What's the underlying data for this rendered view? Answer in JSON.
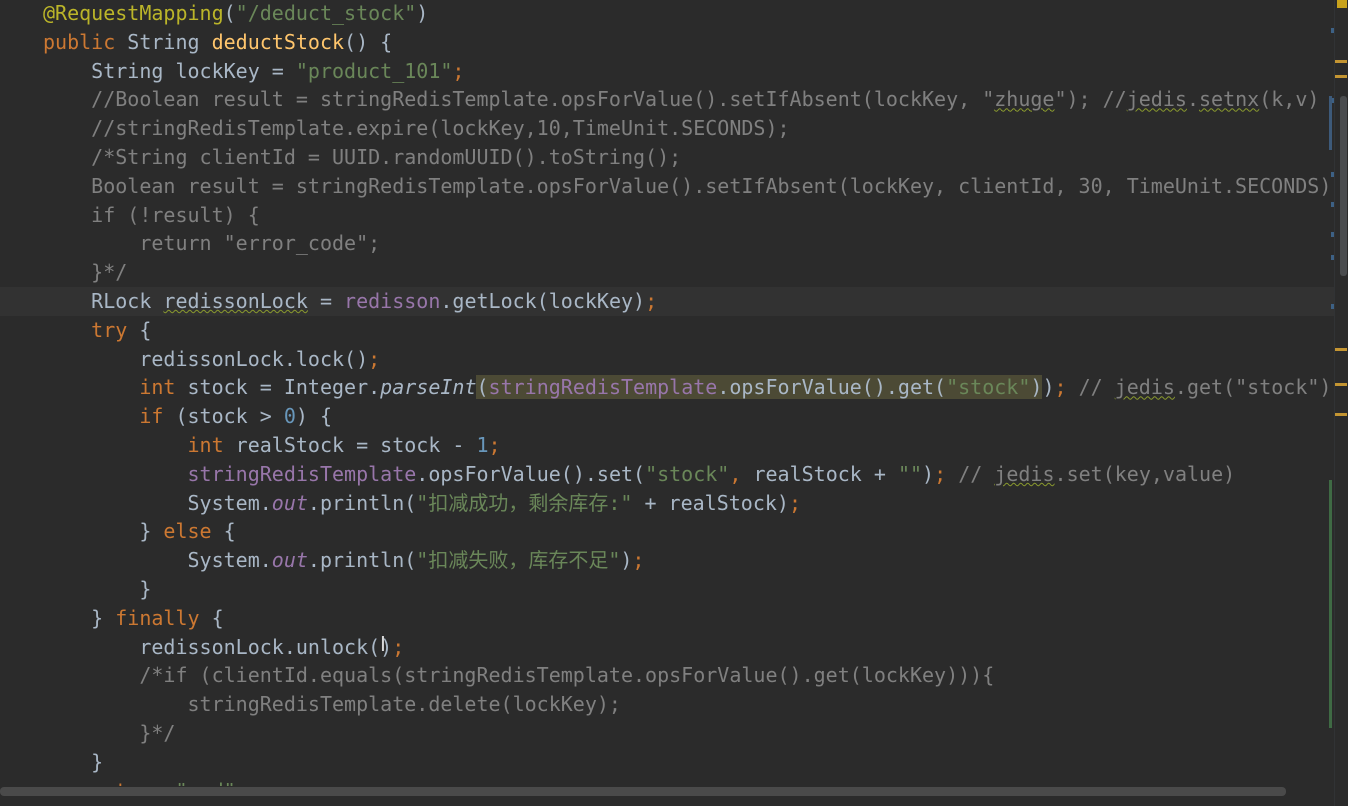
{
  "editor": {
    "theme_colors": {
      "background": "#2b2b2b",
      "current_line": "#323232",
      "keyword": "#cc7832",
      "string": "#6a8759",
      "comment": "#808080",
      "annotation": "#bbb529",
      "field": "#9876aa",
      "method_decl": "#ffc66d",
      "number": "#6897bb",
      "text": "#a9b7c6",
      "usage_highlight": "#4c4a35"
    },
    "lines": [
      [
        {
          "t": "@RequestMapping",
          "c": "ann"
        },
        {
          "t": "(",
          "c": ""
        },
        {
          "t": "\"/deduct_stock\"",
          "c": "str"
        },
        {
          "t": ")",
          "c": ""
        }
      ],
      [
        {
          "t": "public ",
          "c": "kw"
        },
        {
          "t": "String ",
          "c": ""
        },
        {
          "t": "deductStock",
          "c": "fn"
        },
        {
          "t": "() {",
          "c": ""
        }
      ],
      [
        {
          "t": "    String lockKey = ",
          "c": ""
        },
        {
          "t": "\"product_101\"",
          "c": "str"
        },
        {
          "t": ";",
          "c": "kw"
        }
      ],
      [
        {
          "t": "    //Boolean result = stringRedisTemplate.opsForValue().setIfAbsent(lockKey, \"",
          "c": "cmt"
        },
        {
          "t": "zhuge",
          "c": "cmt warn-ul"
        },
        {
          "t": "\"); //",
          "c": "cmt"
        },
        {
          "t": "jedis",
          "c": "cmt warn-ul"
        },
        {
          "t": ".",
          "c": "cmt"
        },
        {
          "t": "setnx",
          "c": "cmt warn-ul"
        },
        {
          "t": "(k,v)",
          "c": "cmt"
        }
      ],
      [
        {
          "t": "    //stringRedisTemplate.expire(lockKey,10,TimeUnit.SECONDS);",
          "c": "cmt"
        }
      ],
      [
        {
          "t": "    /*String clientId = UUID.randomUUID().toString();",
          "c": "cmt"
        }
      ],
      [
        {
          "t": "    Boolean result = stringRedisTemplate.opsForValue().setIfAbsent(lockKey, clientId, 30, TimeUnit.SECONDS);",
          "c": "cmt"
        }
      ],
      [
        {
          "t": "    if (!result) {",
          "c": "cmt"
        }
      ],
      [
        {
          "t": "        return \"error_code\";",
          "c": "cmt"
        }
      ],
      [
        {
          "t": "    }*/",
          "c": "cmt"
        }
      ],
      [
        {
          "t": "    RLock ",
          "c": ""
        },
        {
          "t": "redissonLock",
          "c": "warn-ul"
        },
        {
          "t": " = ",
          "c": ""
        },
        {
          "t": "redisson",
          "c": "fld"
        },
        {
          "t": ".getLock(lockKey)",
          "c": ""
        },
        {
          "t": ";",
          "c": "kw"
        }
      ],
      [
        {
          "t": "    ",
          "c": ""
        },
        {
          "t": "try ",
          "c": "kw"
        },
        {
          "t": "{",
          "c": ""
        }
      ],
      [
        {
          "t": "        redissonLock.lock()",
          "c": ""
        },
        {
          "t": ";",
          "c": "kw"
        }
      ],
      [
        {
          "t": "        ",
          "c": ""
        },
        {
          "t": "int ",
          "c": "kw"
        },
        {
          "t": "stock = Integer.",
          "c": ""
        },
        {
          "t": "parseInt",
          "c": "ital"
        },
        {
          "t": "(",
          "c": "hl"
        },
        {
          "t": "stringRedisTemplate",
          "c": "fld hl"
        },
        {
          "t": ".opsForValue().get(",
          "c": "hl"
        },
        {
          "t": "\"stock\"",
          "c": "str hl"
        },
        {
          "t": ")",
          "c": "hl"
        },
        {
          "t": ")",
          "c": ""
        },
        {
          "t": "; ",
          "c": "kw"
        },
        {
          "t": "// ",
          "c": "cmt"
        },
        {
          "t": "jedis",
          "c": "cmt warn-ul"
        },
        {
          "t": ".get(\"stock\");",
          "c": "cmt"
        }
      ],
      [
        {
          "t": "        ",
          "c": ""
        },
        {
          "t": "if ",
          "c": "kw"
        },
        {
          "t": "(stock > ",
          "c": ""
        },
        {
          "t": "0",
          "c": "num"
        },
        {
          "t": ") {",
          "c": ""
        }
      ],
      [
        {
          "t": "            ",
          "c": ""
        },
        {
          "t": "int ",
          "c": "kw"
        },
        {
          "t": "realStock = stock - ",
          "c": ""
        },
        {
          "t": "1",
          "c": "num"
        },
        {
          "t": ";",
          "c": "kw"
        }
      ],
      [
        {
          "t": "            ",
          "c": ""
        },
        {
          "t": "stringRedisTemplate",
          "c": "fld"
        },
        {
          "t": ".opsForValue().set(",
          "c": ""
        },
        {
          "t": "\"stock\"",
          "c": "str"
        },
        {
          "t": ", ",
          "c": "kw"
        },
        {
          "t": "realStock + ",
          "c": ""
        },
        {
          "t": "\"\"",
          "c": "str"
        },
        {
          "t": ")",
          "c": ""
        },
        {
          "t": "; ",
          "c": "kw"
        },
        {
          "t": "// ",
          "c": "cmt"
        },
        {
          "t": "jedis",
          "c": "cmt warn-ul"
        },
        {
          "t": ".set(key,value)",
          "c": "cmt"
        }
      ],
      [
        {
          "t": "            System.",
          "c": ""
        },
        {
          "t": "out",
          "c": "fld ital"
        },
        {
          "t": ".println(",
          "c": ""
        },
        {
          "t": "\"扣减成功，剩余库存:\"",
          "c": "str"
        },
        {
          "t": " + realStock)",
          "c": ""
        },
        {
          "t": ";",
          "c": "kw"
        }
      ],
      [
        {
          "t": "        } ",
          "c": ""
        },
        {
          "t": "else ",
          "c": "kw"
        },
        {
          "t": "{",
          "c": ""
        }
      ],
      [
        {
          "t": "            System.",
          "c": ""
        },
        {
          "t": "out",
          "c": "fld ital"
        },
        {
          "t": ".println(",
          "c": ""
        },
        {
          "t": "\"扣减失败，库存不足\"",
          "c": "str"
        },
        {
          "t": ")",
          "c": ""
        },
        {
          "t": ";",
          "c": "kw"
        }
      ],
      [
        {
          "t": "        }",
          "c": ""
        }
      ],
      [
        {
          "t": "    } ",
          "c": ""
        },
        {
          "t": "finally ",
          "c": "kw"
        },
        {
          "t": "{",
          "c": ""
        }
      ],
      [
        {
          "t": "        redissonLock.unlock(",
          "c": ""
        },
        {
          "t": ")",
          "c": ""
        },
        {
          "t": ";",
          "c": "kw"
        }
      ],
      [
        {
          "t": "        /*if (clientId.equals(stringRedisTemplate.opsForValue().get(lockKey))){",
          "c": "cmt"
        }
      ],
      [
        {
          "t": "            stringRedisTemplate.delete(lockKey);",
          "c": "cmt"
        }
      ],
      [
        {
          "t": "        }*/",
          "c": "cmt"
        }
      ],
      [
        {
          "t": "    }",
          "c": ""
        }
      ],
      [
        {
          "t": "    ",
          "c": ""
        },
        {
          "t": "return ",
          "c": "kw"
        },
        {
          "t": "\"end\"",
          "c": "str"
        },
        {
          "t": ";",
          "c": "kw"
        }
      ]
    ],
    "current_line_index": 10,
    "text_cursor_icon": "I",
    "scroll_markers": [
      "warning",
      "warning",
      "warning",
      "warning",
      "warning",
      "info",
      "info",
      "info",
      "info",
      "info",
      "info",
      "info"
    ]
  }
}
